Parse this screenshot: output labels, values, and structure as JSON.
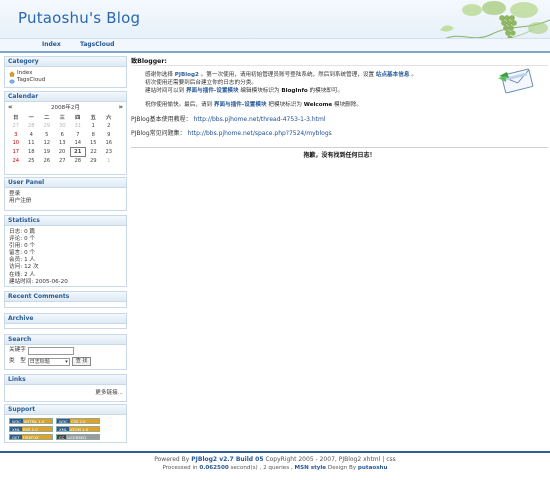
{
  "header": {
    "title": "Putaoshu's Blog"
  },
  "nav": {
    "index": "Index",
    "tags": "TagsCloud"
  },
  "sidebar": {
    "category": {
      "title": "Category",
      "items": [
        "Index",
        "TagsCloud"
      ]
    },
    "calendar": {
      "title": "Calendar",
      "prev": "«",
      "next": "»",
      "month_label": "2008年2月",
      "weekdays": [
        "日",
        "一",
        "二",
        "三",
        "四",
        "五",
        "六"
      ],
      "weeks": [
        [
          "27",
          "28",
          "29",
          "30",
          "31",
          "1",
          "2"
        ],
        [
          "3",
          "4",
          "5",
          "6",
          "7",
          "8",
          "9"
        ],
        [
          "10",
          "11",
          "12",
          "13",
          "14",
          "15",
          "16"
        ],
        [
          "17",
          "18",
          "19",
          "20",
          "21",
          "22",
          "23"
        ],
        [
          "24",
          "25",
          "26",
          "27",
          "28",
          "29",
          "1"
        ]
      ],
      "today": "21"
    },
    "user_panel": {
      "title": "User Panel",
      "items": [
        "登录",
        "用户注册"
      ]
    },
    "statistics": {
      "title": "Statistics",
      "rows": [
        {
          "label": "日志:",
          "value": "0 篇"
        },
        {
          "label": "评论:",
          "value": "0 个"
        },
        {
          "label": "引用:",
          "value": "0 个"
        },
        {
          "label": "留言:",
          "value": "0 个"
        },
        {
          "label": "会员:",
          "value": "1 人"
        },
        {
          "label": "访问:",
          "value": "12 次"
        },
        {
          "label": "在线:",
          "value": "2 人"
        },
        {
          "label": "建站时间:",
          "value": "2005-06-20"
        }
      ]
    },
    "recent_comments": {
      "title": "Recent Comments"
    },
    "archive": {
      "title": "Archive"
    },
    "search": {
      "title": "Search",
      "keyword_label": "关键字",
      "type_label": "类　型",
      "type_value": "日志标题",
      "button": "查 找"
    },
    "links": {
      "title": "Links",
      "more": "更多链接..."
    },
    "support": {
      "title": "Support",
      "badges": [
        {
          "left": "W3C",
          "right": "XHTML 1.0"
        },
        {
          "left": "W3C",
          "right": "CSS 2.0"
        },
        {
          "left": "XML",
          "right": "RSS 2.0"
        },
        {
          "left": "XML",
          "right": "ATOM 1.0"
        },
        {
          "left": "GET",
          "right": "FIREFOX"
        },
        {
          "left": "CC",
          "right": "LICENSED"
        }
      ]
    }
  },
  "main": {
    "greeting": "致Blogger:",
    "line1_a": "感谢你选择",
    "line1_b": "PJBlog2",
    "line1_c": "。第一次使用，请用初始管理员账号登陆系统，然后到系统管理，设置",
    "line1_d": "站点基本信息",
    "line1_e": "。",
    "line2": "初次使用还需要到后台建立你的日志的分类。",
    "line3_a": "建站时间可以到",
    "line3_b": "界面与插件-设置模块",
    "line3_c": "编辑模块标识为",
    "line3_d": "BlogInfo",
    "line3_e": "的模块即可。",
    "line4_a": "祝你使用愉快。最后，请到",
    "line4_b": "界面与插件-设置模块",
    "line4_c": "把模块标识为",
    "line4_d": "Welcome",
    "line4_e": "模块删除。",
    "tutorial_label": "PJBlog基本使用教程：",
    "tutorial_url": "http://bbs.pjhome.net/thread-4753-1-3.html",
    "faq_label": "PJBlog常见问题集：",
    "faq_url": "http://bbs.pjhome.net/space.php?7524/myblogs",
    "no_posts": "抱歉，没有找到任何日志！"
  },
  "footer": {
    "powered_prefix": "Powered By",
    "powered_product": "PJBlog2 v2.7 Build 05",
    "copyright": "CopyRight 2005 - 2007, PJBlog2",
    "xhtml": "xhtml",
    "sep": "|",
    "css": "css",
    "processed_prefix": "Processed in",
    "processed_time": "0.062500",
    "processed_mid": "second(s) , 2 queries ,",
    "style_name": "MSN style",
    "design_by": "Design By",
    "designer": "putaoshu"
  }
}
